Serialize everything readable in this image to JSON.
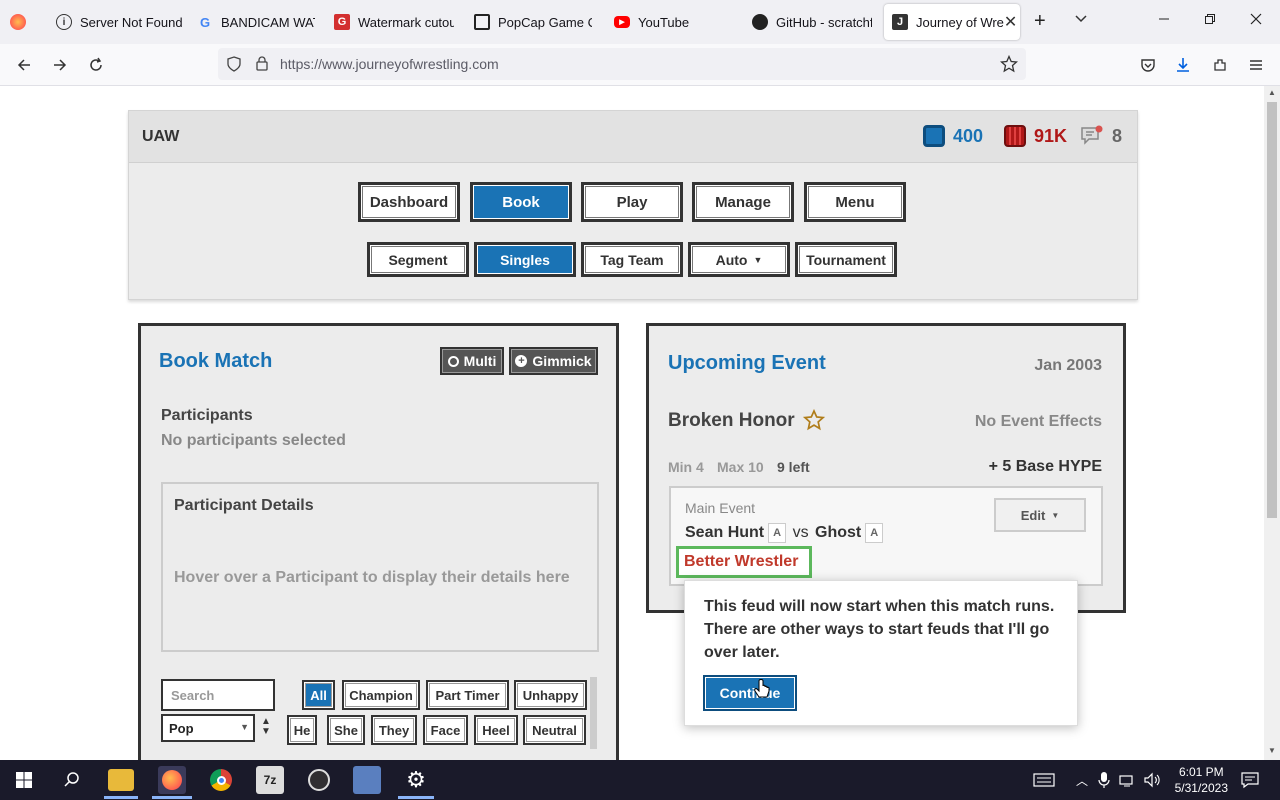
{
  "browser": {
    "tabs": [
      {
        "label": "",
        "icon": "firefox-icon"
      },
      {
        "label": "Server Not Found",
        "icon": "info-icon"
      },
      {
        "label": "BANDICAM WATE",
        "icon": "google-icon"
      },
      {
        "label": "Watermark cutout",
        "icon": "watermark-g-icon"
      },
      {
        "label": "PopCap Game Col",
        "icon": "archive-icon"
      },
      {
        "label": "YouTube",
        "icon": "youtube-icon"
      },
      {
        "label": "GitHub - scratchfo",
        "icon": "github-icon"
      },
      {
        "label": "Journey of Wre",
        "icon": "journey-icon"
      }
    ],
    "active_tab_close": "✕",
    "new_tab": "+",
    "url": "https://www.journeyofwrestling.com"
  },
  "game": {
    "org_name": "UAW",
    "stats": {
      "credits": "400",
      "money": "91K",
      "messages": "8"
    },
    "main_nav": [
      "Dashboard",
      "Book",
      "Play",
      "Manage",
      "Menu"
    ],
    "sub_nav": [
      "Segment",
      "Singles",
      "Tag Team",
      "Auto",
      "Tournament"
    ]
  },
  "book_match": {
    "title": "Book Match",
    "multi_label": "Multi",
    "gimmick_label": "Gimmick",
    "participants_heading": "Participants",
    "participants_status": "No participants selected",
    "details_heading": "Participant Details",
    "details_hint": "Hover over a Participant to display their details here",
    "search_placeholder": "Search",
    "sort_value": "Pop",
    "filters_row1": [
      "All",
      "Champion",
      "Part Timer",
      "Unhappy"
    ],
    "filters_row2": [
      "He",
      "She",
      "They",
      "Face",
      "Heel",
      "Neutral"
    ]
  },
  "upcoming_event": {
    "title": "Upcoming Event",
    "date": "Jan 2003",
    "event_name": "Broken Honor",
    "effects": "No Event Effects",
    "min": "Min 4",
    "max": "Max 10",
    "left": "9 left",
    "hype": "+ 5 Base HYPE",
    "match_label": "Main Event",
    "wrestler1": "Sean Hunt",
    "vs": "vs",
    "wrestler2": "Ghost",
    "grade": "A",
    "edit_label": "Edit",
    "highlight": "Better Wrestler"
  },
  "popover": {
    "text": "This feud will now start when this match runs. There are other ways to start feuds that I'll go over later.",
    "button": "Continue"
  },
  "taskbar": {
    "time": "6:01 PM",
    "date": "5/31/2023"
  },
  "colors": {
    "accent_blue": "#1a73b5",
    "money_red": "#b01818",
    "highlight_red": "#c0392b",
    "highlight_green": "#5cb85c"
  }
}
